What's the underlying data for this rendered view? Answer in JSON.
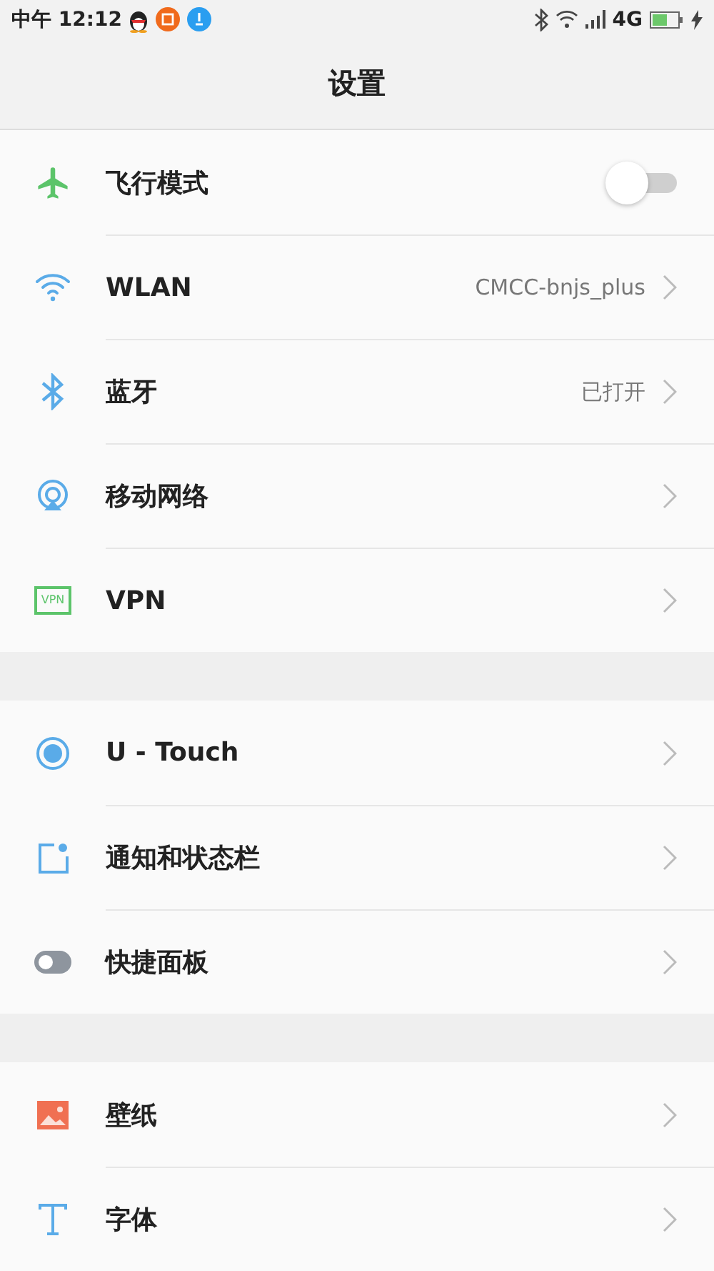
{
  "status_bar": {
    "time": "中午 12:12",
    "network": "4G"
  },
  "header": {
    "title": "设置"
  },
  "groups": [
    {
      "rows": [
        {
          "label": "飞行模式",
          "kind": "toggle",
          "on": false
        },
        {
          "label": "WLAN",
          "kind": "link",
          "value": "CMCC-bnjs_plus"
        },
        {
          "label": "蓝牙",
          "kind": "link",
          "value": "已打开"
        },
        {
          "label": "移动网络",
          "kind": "link"
        },
        {
          "badge": "VPN",
          "label": "VPN",
          "kind": "link"
        }
      ]
    },
    {
      "rows": [
        {
          "label": "U - Touch",
          "kind": "link"
        },
        {
          "label": "通知和状态栏",
          "kind": "link"
        },
        {
          "label": "快捷面板",
          "kind": "link"
        }
      ]
    },
    {
      "rows": [
        {
          "label": "壁纸",
          "kind": "link"
        },
        {
          "label": "字体",
          "kind": "link"
        }
      ]
    }
  ]
}
